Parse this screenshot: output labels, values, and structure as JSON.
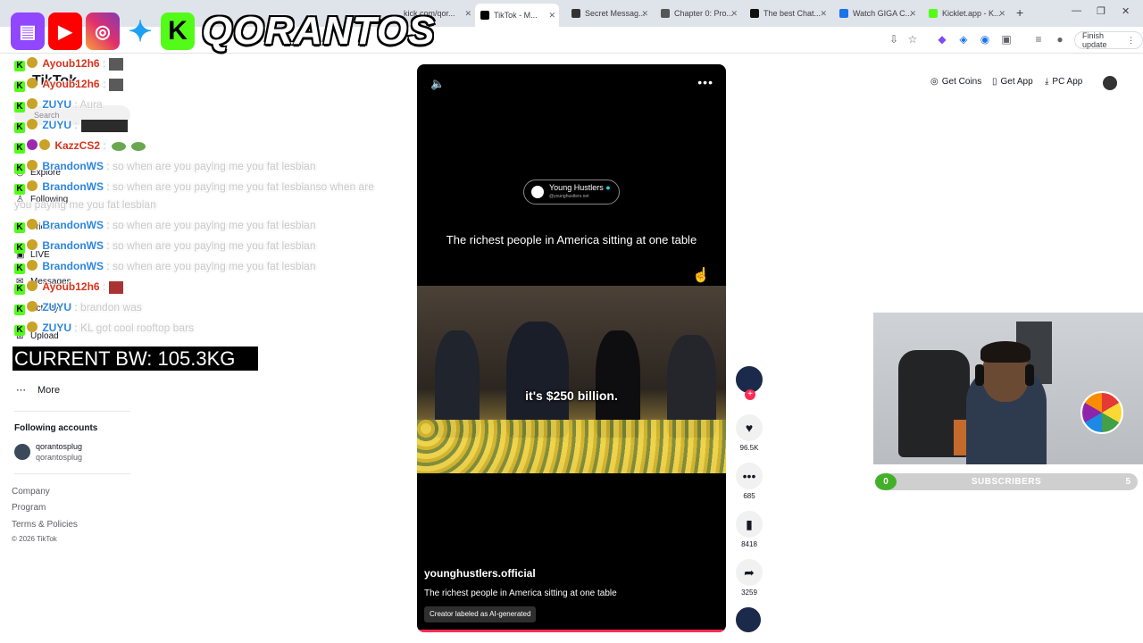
{
  "browser": {
    "tabs": [
      {
        "label": "kick.com/qor...",
        "color": "#53fc18"
      },
      {
        "label": "TikTok - M...",
        "color": "#000000",
        "active": true
      },
      {
        "label": "Secret Messag...",
        "color": "#333333"
      },
      {
        "label": "Chapter 0: Pro...",
        "color": "#555555"
      },
      {
        "label": "The best Chat...",
        "color": "#111111"
      },
      {
        "label": "Watch GIGA C...",
        "color": "#1a73e8"
      },
      {
        "label": "Kicklet.app - K...",
        "color": "#53fc18"
      }
    ],
    "finish_update": "Finish update"
  },
  "overlay": {
    "streamer_name": "QORANTOS",
    "body_weight": "CURRENT BW: 105.3KG"
  },
  "chat": [
    {
      "user": "Ayoub12h6",
      "color": "#d9331c",
      "message": ":",
      "emote": "image"
    },
    {
      "user": "Ayoub12h6",
      "color": "#d9331c",
      "message": ":",
      "emote": "image"
    },
    {
      "user": "ZUYU",
      "color": "#2e86de",
      "message": ": Aura"
    },
    {
      "user": "ZUYU",
      "color": "#2e86de",
      "message": ":",
      "emote": "wide"
    },
    {
      "user": "KazzCS2",
      "color": "#d9331c",
      "message": ":",
      "emote": "frogs"
    },
    {
      "user": "BrandonWS",
      "color": "#2e86de",
      "message": ": so when are you paying me you fat lesbian"
    },
    {
      "user": "BrandonWS",
      "color": "#2e86de",
      "message": ": so when are you paying me you fat lesbianso when are"
    },
    {
      "user": "BrandonWS",
      "color": "#2e86de",
      "message": ": so when are you paying me you fat lesbian"
    },
    {
      "user": "BrandonWS",
      "color": "#2e86de",
      "message": ": so when are you paying me you fat lesbian"
    },
    {
      "user": "BrandonWS",
      "color": "#2e86de",
      "message": ": so when are you paying me you fat lesbian"
    },
    {
      "user": "Ayoub12h6",
      "color": "#d9331c",
      "message": ":",
      "emote": "image"
    },
    {
      "user": "ZUYU",
      "color": "#2e86de",
      "message": ": brandon was"
    },
    {
      "user": "ZUYU",
      "color": "#2e86de",
      "message": ": KL got cool rooftop bars"
    }
  ],
  "chat_wrap": "you paying me you fat lesbian",
  "tiktok": {
    "brand": "TikTok",
    "search_placeholder": "Search",
    "nav": [
      "Explore",
      "Following",
      "Friends",
      "LIVE",
      "Messages",
      "Activity",
      "Upload"
    ],
    "more": "More",
    "following_header": "Following accounts",
    "account_name": "qorantosplug",
    "account_handle": "qorantosplug",
    "footer": [
      "Company",
      "Program",
      "Terms & Policies",
      "© 2026 TikTok"
    ],
    "header_buttons": [
      "Get Coins",
      "Get App",
      "PC App"
    ]
  },
  "video": {
    "badge_name": "Young Hustlers",
    "badge_handle": "@younghustlers.net",
    "headline": "The richest people in America sitting at one table",
    "subtitle": "it's $250 billion.",
    "author": "younghustlers.official",
    "description": "The richest people in America sitting at one table",
    "ai_label": "Creator labeled as AI-generated"
  },
  "actions": {
    "likes": "96.5K",
    "comments": "685",
    "saves": "8418",
    "shares": "3259"
  },
  "subscribers": {
    "current": "0",
    "label": "SUBSCRIBERS",
    "goal": "5"
  }
}
